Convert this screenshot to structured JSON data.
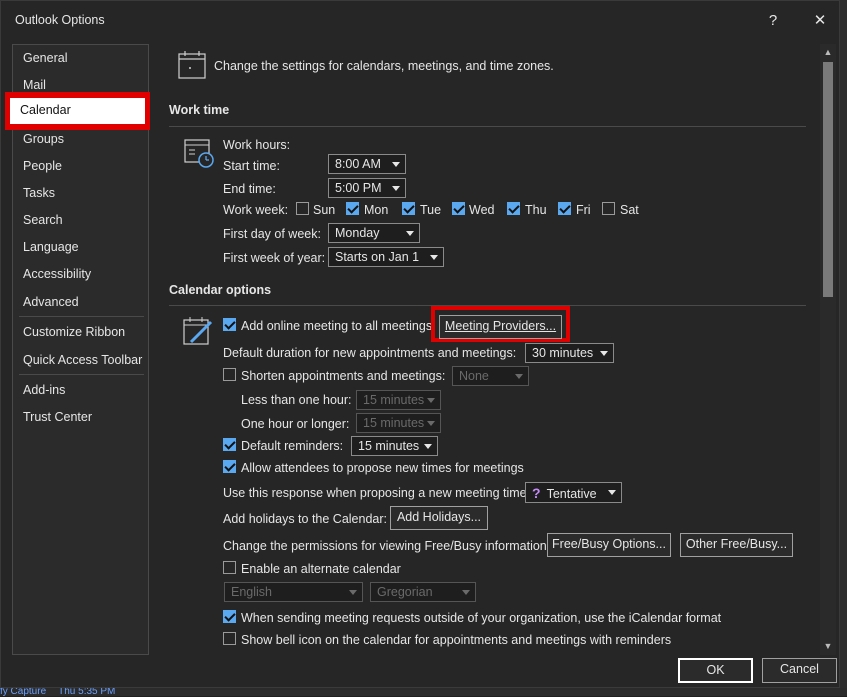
{
  "window": {
    "title": "Outlook Options",
    "help": "?",
    "close": "✕"
  },
  "nav": {
    "items": [
      "General",
      "Mail",
      "Calendar",
      "Groups",
      "People",
      "Tasks",
      "Search",
      "Language",
      "Accessibility",
      "Advanced",
      "Customize Ribbon",
      "Quick Access Toolbar",
      "Add-ins",
      "Trust Center"
    ],
    "selected": "Calendar"
  },
  "header": {
    "text": "Change the settings for calendars, meetings, and time zones."
  },
  "work_time": {
    "heading": "Work time",
    "work_hours_label": "Work hours:",
    "start_label": "Start time:",
    "start_value": "8:00 AM",
    "end_label": "End time:",
    "end_value": "5:00 PM",
    "work_week_label": "Work week:",
    "days": [
      {
        "label": "Sun",
        "checked": false
      },
      {
        "label": "Mon",
        "checked": true
      },
      {
        "label": "Tue",
        "checked": true
      },
      {
        "label": "Wed",
        "checked": true
      },
      {
        "label": "Thu",
        "checked": true
      },
      {
        "label": "Fri",
        "checked": true
      },
      {
        "label": "Sat",
        "checked": false
      }
    ],
    "first_day_label": "First day of week:",
    "first_day_value": "Monday",
    "first_week_label": "First week of year:",
    "first_week_value": "Starts on Jan 1"
  },
  "calendar_options": {
    "heading": "Calendar options",
    "add_online_meeting": "Add online meeting to all meetings",
    "meeting_providers": "Meeting Providers...",
    "default_duration_label": "Default duration for new appointments and meetings:",
    "default_duration_value": "30 minutes",
    "shorten_label": "Shorten appointments and meetings:",
    "shorten_value": "None",
    "less_than_hour_label": "Less than one hour:",
    "less_than_hour_value": "15 minutes",
    "hour_or_longer_label": "One hour or longer:",
    "hour_or_longer_value": "15 minutes",
    "default_reminders_label": "Default reminders:",
    "default_reminders_value": "15 minutes",
    "allow_attendees": "Allow attendees to propose new times for meetings",
    "use_response_label": "Use this response when proposing a new meeting time:",
    "use_response_value": "Tentative",
    "use_response_icon": "?",
    "holidays_label": "Add holidays to the Calendar:",
    "add_holidays": "Add Holidays...",
    "permissions_label": "Change the permissions for viewing Free/Busy information:",
    "free_busy_options": "Free/Busy Options...",
    "other_free_busy": "Other Free/Busy...",
    "alternate_calendar": "Enable an alternate calendar",
    "alt_language": "English",
    "alt_type": "Gregorian",
    "icalendar": "When sending meeting requests outside of your organization, use the iCalendar format",
    "bell_icon": "Show bell icon on the calendar for appointments and meetings with reminders"
  },
  "footer": {
    "ok": "OK",
    "cancel": "Cancel"
  },
  "background_peek": {
    "left": "fy Capture",
    "right": "Thu 5:35 PM"
  },
  "colors": {
    "highlight": "#e00000",
    "checkbox": "#5aa8f0",
    "background": "#262626"
  }
}
